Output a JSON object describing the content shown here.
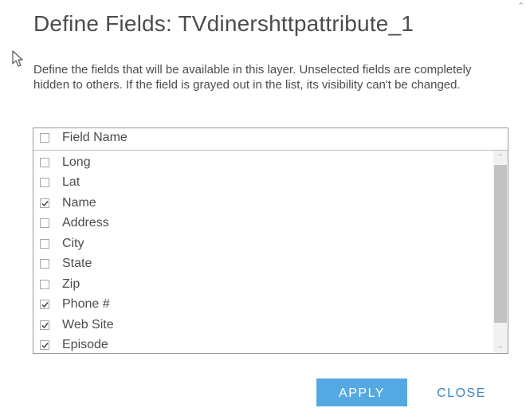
{
  "dialog": {
    "title": "Define Fields: TVdinershttpattribute_1",
    "description": "Define the fields that will be available in this layer. Unselected fields are completely hidden to others. If the field is grayed out in the list, its visibility can't be changed."
  },
  "list": {
    "header_label": "Field Name",
    "header_checked": false,
    "fields": [
      {
        "label": "Long",
        "checked": false
      },
      {
        "label": "Lat",
        "checked": false
      },
      {
        "label": "Name",
        "checked": true
      },
      {
        "label": "Address",
        "checked": false
      },
      {
        "label": "City",
        "checked": false
      },
      {
        "label": "State",
        "checked": false
      },
      {
        "label": "Zip",
        "checked": false
      },
      {
        "label": "Phone #",
        "checked": true
      },
      {
        "label": "Web Site",
        "checked": true
      },
      {
        "label": "Episode",
        "checked": true
      }
    ]
  },
  "buttons": {
    "apply_label": "APPLY",
    "close_label": "CLOSE"
  },
  "colors": {
    "apply_bg": "#55a9e2",
    "close_text": "#3b86c2",
    "text": "#4c4c4c"
  },
  "icons": {
    "pointer": "cursor-pointer-icon",
    "check": "check-icon",
    "corner": "corner-indicator-icon"
  }
}
